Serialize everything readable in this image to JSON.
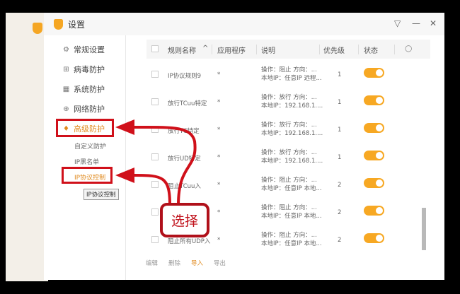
{
  "window": {
    "title": "设置",
    "controls": [
      "▽",
      "—",
      "✕"
    ]
  },
  "sidebar": {
    "items": [
      {
        "label": "常规设置",
        "icon": "gear-icon",
        "glyph": "⚙"
      },
      {
        "label": "病毒防护",
        "icon": "plus-box-icon",
        "glyph": "⊞"
      },
      {
        "label": "系统防护",
        "icon": "system-icon",
        "glyph": "▦"
      },
      {
        "label": "网络防护",
        "icon": "globe-icon",
        "glyph": "⊕"
      },
      {
        "label": "高级防护",
        "icon": "diamond-icon",
        "glyph": "♦"
      }
    ],
    "subitems": [
      "自定义防护",
      "IP黑名单",
      "IP协议控制"
    ],
    "tooltip": "IP协议控制"
  },
  "table": {
    "headers": [
      "规则名称",
      "应用程序",
      "说明",
      "优先级",
      "状态"
    ],
    "sort_indicator": "^",
    "rows": [
      {
        "name": "IP协议规则9",
        "app": "*",
        "desc1": "操作：阻止 方向：...",
        "desc2": "本地IP：任意IP 远程...",
        "priority": "1",
        "enabled": true
      },
      {
        "name": "放行TCuu特定",
        "app": "*",
        "desc1": "操作：放行 方向：...",
        "desc2": "本地IP：192.168.1....",
        "priority": "1",
        "enabled": true
      },
      {
        "name": "放行TC特定",
        "app": "*",
        "desc1": "操作：放行 方向：...",
        "desc2": "本地IP：192.168.1....",
        "priority": "1",
        "enabled": true
      },
      {
        "name": "放行UD特定",
        "app": "*",
        "desc1": "操作：放行 方向：...",
        "desc2": "本地IP：192.168.1....",
        "priority": "1",
        "enabled": true
      },
      {
        "name": "阻止TCuu入",
        "app": "*",
        "desc1": "操作：阻止 方向：...",
        "desc2": "本地IP：任意IP 本地...",
        "priority": "2",
        "enabled": true
      },
      {
        "name": "",
        "app": "*",
        "desc1": "操作：阻止 方向：...",
        "desc2": "本地IP：任意IP 本地...",
        "priority": "2",
        "enabled": true
      },
      {
        "name": "阻止所有UDP入",
        "app": "*",
        "desc1": "操作：阻止 方向：...",
        "desc2": "本地IP：任意IP 本地...",
        "priority": "2",
        "enabled": true
      }
    ]
  },
  "footer": {
    "buttons": [
      "编辑",
      "删除",
      "导入",
      "导出"
    ]
  },
  "annotation": {
    "callout": "选择",
    "colors": {
      "accent": "#f7a823",
      "annotation": "#d0101a"
    }
  }
}
